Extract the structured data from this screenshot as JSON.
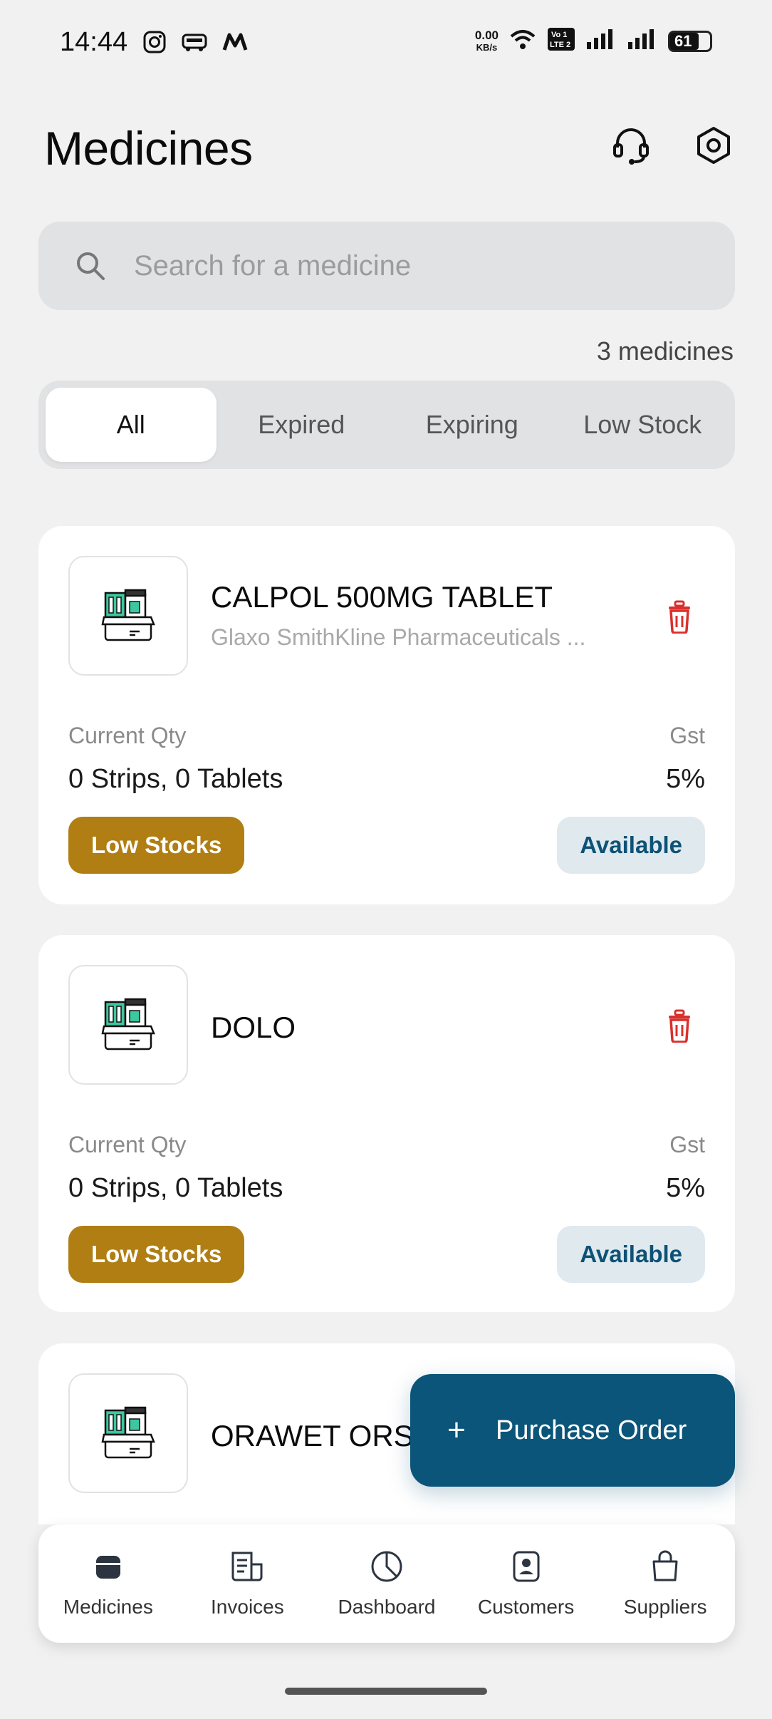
{
  "status_bar": {
    "time": "14:44",
    "net_speed": "0.00",
    "net_unit": "KB/s",
    "battery": "61",
    "app_icons": [
      "instagram-icon",
      "redbus-icon",
      "m-app-icon"
    ]
  },
  "header": {
    "title": "Medicines",
    "icons": [
      "headset-icon",
      "settings-icon"
    ]
  },
  "search": {
    "placeholder": "Search for a medicine",
    "value": ""
  },
  "list_count": "3 medicines",
  "tabs": [
    {
      "label": "All",
      "active": true
    },
    {
      "label": "Expired",
      "active": false
    },
    {
      "label": "Expiring",
      "active": false
    },
    {
      "label": "Low Stock",
      "active": false
    }
  ],
  "medicines": [
    {
      "name": "CALPOL 500MG TABLET",
      "manufacturer": "Glaxo SmithKline Pharmaceuticals ...",
      "qty_label": "Current Qty",
      "qty": "0 Strips, 0 Tablets",
      "gst_label": "Gst",
      "gst": "5%",
      "stock_badge": "Low Stocks",
      "status_badge": "Available"
    },
    {
      "name": "DOLO",
      "manufacturer": "",
      "qty_label": "Current Qty",
      "qty": "0 Strips, 0 Tablets",
      "gst_label": "Gst",
      "gst": "5%",
      "stock_badge": "Low Stocks",
      "status_badge": "Available"
    },
    {
      "name": "ORAWET ORS 2"
    }
  ],
  "fab": {
    "icon": "plus-icon",
    "label": "Purchase Order"
  },
  "bottom_nav": [
    {
      "label": "Medicines",
      "icon": "medicines-icon",
      "active": true
    },
    {
      "label": "Invoices",
      "icon": "invoice-icon",
      "active": false
    },
    {
      "label": "Dashboard",
      "icon": "pie-chart-icon",
      "active": false
    },
    {
      "label": "Customers",
      "icon": "customer-icon",
      "active": false
    },
    {
      "label": "Suppliers",
      "icon": "shopping-bag-icon",
      "active": false
    }
  ],
  "colors": {
    "primary": "#0a5579",
    "low_stock": "#b07e12",
    "available_bg": "#dfe9ee",
    "delete": "#d9302c"
  }
}
